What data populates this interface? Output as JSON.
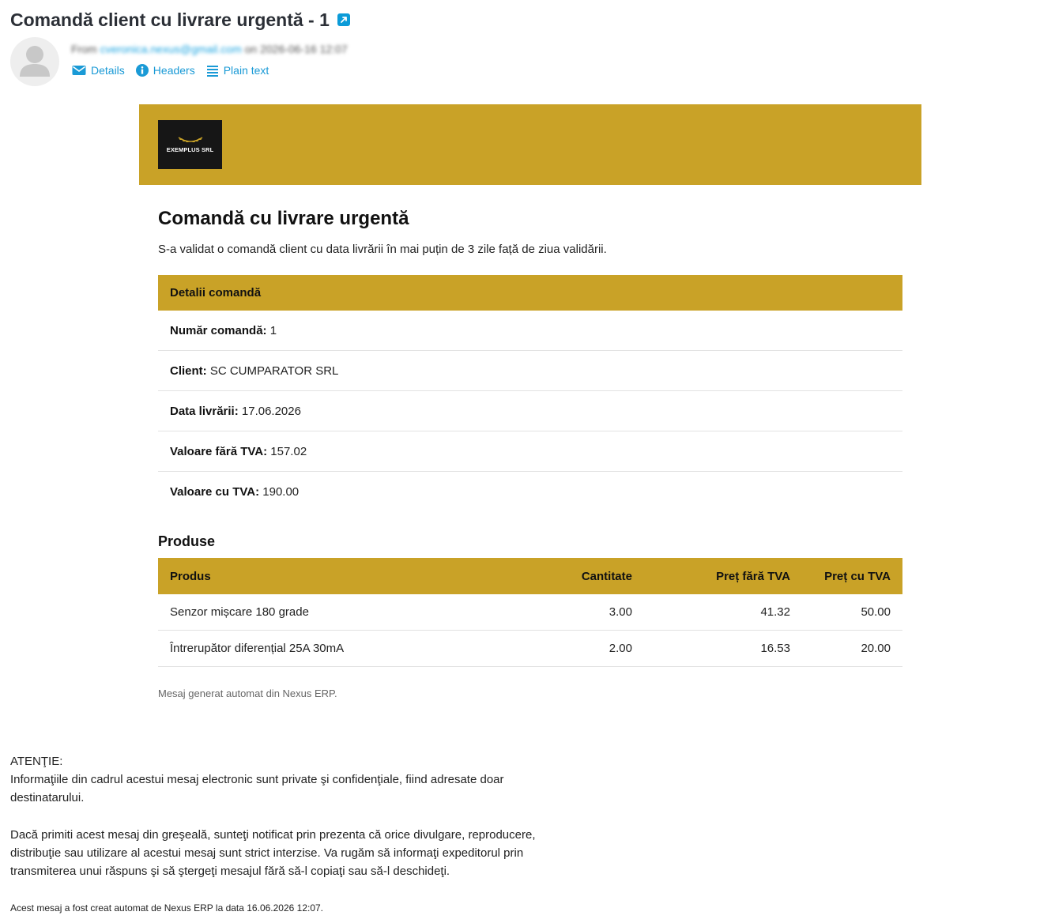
{
  "email": {
    "subject": "Comandă client cu livrare urgentă - 1",
    "from_label": "From",
    "from_address": "cveronica.nexus@gmail.com",
    "on_label": "on",
    "date": "2026-06-16 12:07",
    "links": [
      {
        "label": "Details",
        "icon": "envelope-icon"
      },
      {
        "label": "Headers",
        "icon": "info-icon"
      },
      {
        "label": "Plain text",
        "icon": "list-icon"
      }
    ]
  },
  "colors": {
    "accent": "#c9a227",
    "link": "#1a9ad6"
  },
  "logo": {
    "text": "EXEMPLUS SRL"
  },
  "body": {
    "title": "Comandă cu livrare urgentă",
    "intro": "S-a validat o comandă client cu data livrării în mai puțin de 3 zile față de ziua validării.",
    "details_header": "Detalii comandă",
    "details": [
      {
        "label": "Număr comandă:",
        "value": "1"
      },
      {
        "label": "Client:",
        "value": "SC CUMPARATOR SRL"
      },
      {
        "label": "Data livrării:",
        "value": "17.06.2026"
      },
      {
        "label": "Valoare fără TVA:",
        "value": "157.02"
      },
      {
        "label": "Valoare cu TVA:",
        "value": "190.00"
      }
    ],
    "products_title": "Produse",
    "products_columns": [
      "Produs",
      "Cantitate",
      "Preț fără TVA",
      "Preț cu TVA"
    ],
    "products": [
      {
        "name": "Senzor mișcare 180 grade",
        "qty": "3.00",
        "price_no_vat": "41.32",
        "price_vat": "50.00"
      },
      {
        "name": "Întrerupător diferențial 25A 30mA",
        "qty": "2.00",
        "price_no_vat": "16.53",
        "price_vat": "20.00"
      }
    ],
    "footer_note": "Mesaj generat automat din Nexus ERP."
  },
  "disclaimer": {
    "title": "ATENŢIE:",
    "p1": "Informaţiile din cadrul acestui mesaj electronic sunt private şi confidenţiale, fiind adresate doar destinatarului.",
    "p2": "Dacă primiti acest mesaj din greşeală, sunteţi notificat prin prezenta că orice divulgare, reproducere, distribuţie sau utilizare al acestui mesaj sunt strict interzise. Va rugăm să informaţi expeditorul prin transmiterea unui răspuns şi să ştergeţi mesajul fără să-l copiaţi sau să-l deschideţi.",
    "auto_note": "Acest mesaj a fost creat automat de Nexus ERP la data 16.06.2026 12:07."
  }
}
